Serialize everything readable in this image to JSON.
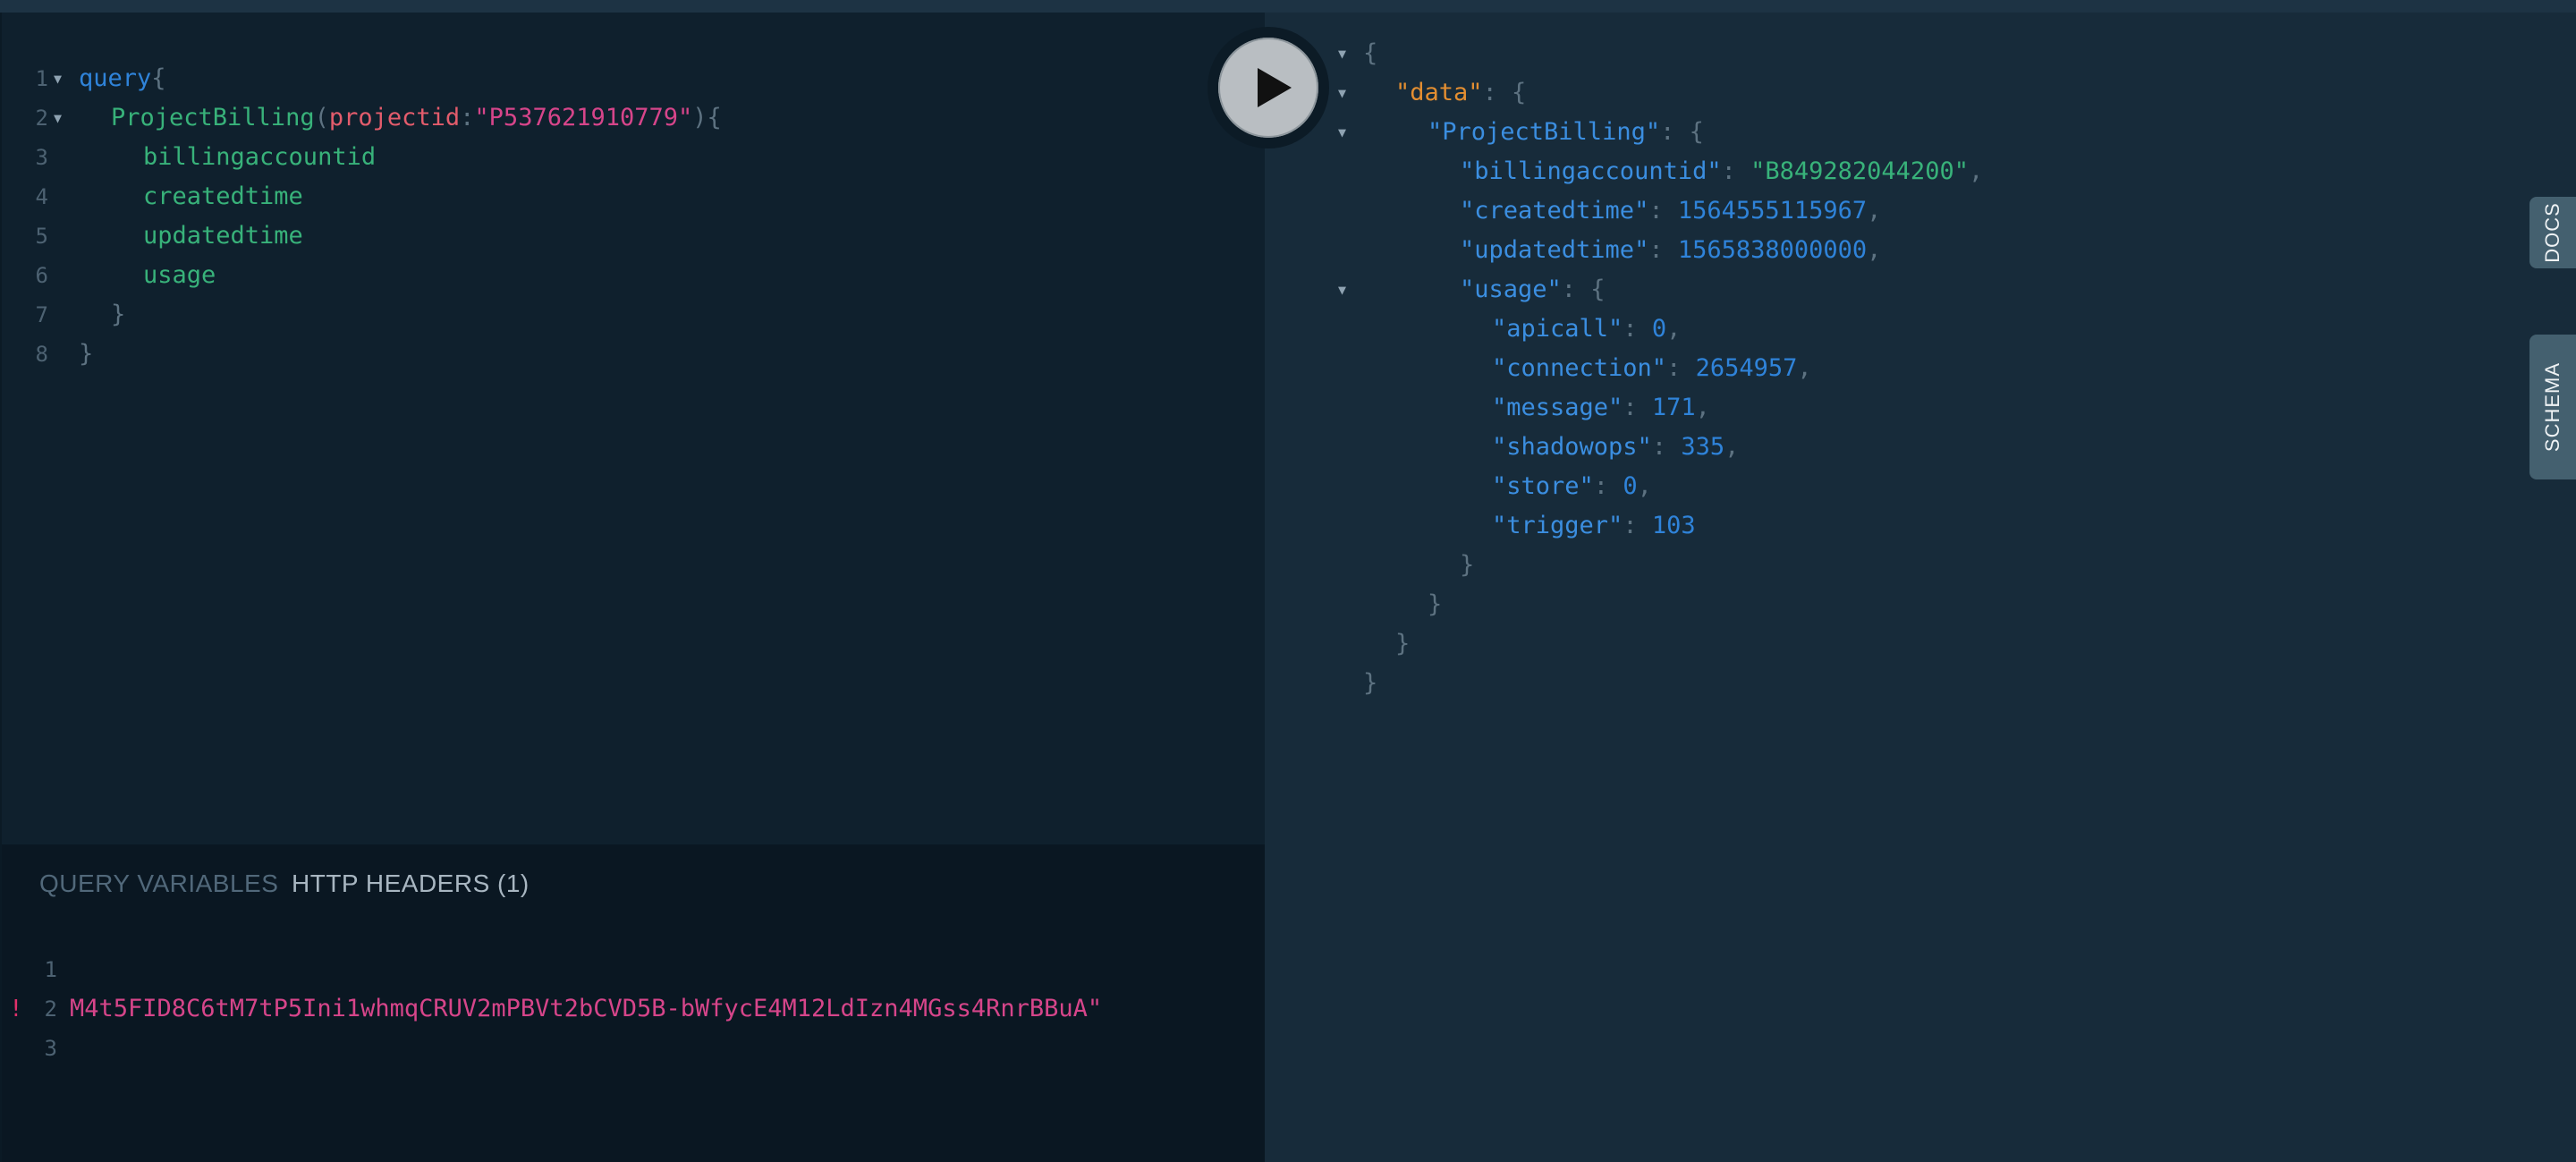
{
  "editor": {
    "lines": [
      {
        "n": "1",
        "fold": true,
        "indent": 0,
        "tokens": [
          {
            "t": "query",
            "c": "kw"
          },
          {
            "t": "{",
            "c": "punc"
          }
        ]
      },
      {
        "n": "2",
        "fold": true,
        "indent": 1,
        "tokens": [
          {
            "t": "ProjectBilling",
            "c": "fn"
          },
          {
            "t": "(",
            "c": "punc"
          },
          {
            "t": "projectid",
            "c": "arg"
          },
          {
            "t": ":",
            "c": "punc"
          },
          {
            "t": "\"P537621910779\"",
            "c": "str"
          },
          {
            "t": "){",
            "c": "punc"
          }
        ]
      },
      {
        "n": "3",
        "fold": false,
        "indent": 2,
        "tokens": [
          {
            "t": "billingaccountid",
            "c": "field"
          }
        ]
      },
      {
        "n": "4",
        "fold": false,
        "indent": 2,
        "tokens": [
          {
            "t": "createdtime",
            "c": "field"
          }
        ]
      },
      {
        "n": "5",
        "fold": false,
        "indent": 2,
        "tokens": [
          {
            "t": "updatedtime",
            "c": "field"
          }
        ]
      },
      {
        "n": "6",
        "fold": false,
        "indent": 2,
        "tokens": [
          {
            "t": "usage",
            "c": "field"
          }
        ]
      },
      {
        "n": "7",
        "fold": false,
        "indent": 1,
        "tokens": [
          {
            "t": "}",
            "c": "punc"
          }
        ]
      },
      {
        "n": "8",
        "fold": false,
        "indent": 0,
        "tokens": [
          {
            "t": "}",
            "c": "punc"
          }
        ]
      }
    ]
  },
  "bottom_tabs": {
    "query_variables": "QUERY VARIABLES",
    "http_headers": "HTTP HEADERS (1)"
  },
  "headers_editor": {
    "lines": [
      {
        "n": "1",
        "text": ""
      },
      {
        "n": "2",
        "text": "M4t5FID8C6tM7tP5Ini1whmqCRUV2mPBVt2bCVD5B-bWfycE4M12LdIzn4MGss4RnrBBuA\""
      },
      {
        "n": "3",
        "text": ""
      }
    ],
    "error_marker": "!"
  },
  "result": {
    "lines": [
      {
        "fold": true,
        "indent": 0,
        "tokens": [
          {
            "t": "{",
            "c": "punc"
          }
        ]
      },
      {
        "fold": true,
        "indent": 1,
        "tokens": [
          {
            "t": "\"data\"",
            "c": "key-data"
          },
          {
            "t": ": {",
            "c": "punc"
          }
        ]
      },
      {
        "fold": true,
        "indent": 2,
        "tokens": [
          {
            "t": "\"ProjectBilling\"",
            "c": "key"
          },
          {
            "t": ": {",
            "c": "punc"
          }
        ]
      },
      {
        "fold": false,
        "indent": 3,
        "tokens": [
          {
            "t": "\"billingaccountid\"",
            "c": "key"
          },
          {
            "t": ": ",
            "c": "punc"
          },
          {
            "t": "\"B849282044200\"",
            "c": "rstr"
          },
          {
            "t": ",",
            "c": "punc"
          }
        ]
      },
      {
        "fold": false,
        "indent": 3,
        "tokens": [
          {
            "t": "\"createdtime\"",
            "c": "key"
          },
          {
            "t": ": ",
            "c": "punc"
          },
          {
            "t": "1564555115967",
            "c": "num"
          },
          {
            "t": ",",
            "c": "punc"
          }
        ]
      },
      {
        "fold": false,
        "indent": 3,
        "tokens": [
          {
            "t": "\"updatedtime\"",
            "c": "key"
          },
          {
            "t": ": ",
            "c": "punc"
          },
          {
            "t": "1565838000000",
            "c": "num"
          },
          {
            "t": ",",
            "c": "punc"
          }
        ]
      },
      {
        "fold": true,
        "indent": 3,
        "tokens": [
          {
            "t": "\"usage\"",
            "c": "key"
          },
          {
            "t": ": {",
            "c": "punc"
          }
        ]
      },
      {
        "fold": false,
        "indent": 4,
        "tokens": [
          {
            "t": "\"apicall\"",
            "c": "key"
          },
          {
            "t": ": ",
            "c": "punc"
          },
          {
            "t": "0",
            "c": "num"
          },
          {
            "t": ",",
            "c": "punc"
          }
        ]
      },
      {
        "fold": false,
        "indent": 4,
        "tokens": [
          {
            "t": "\"connection\"",
            "c": "key"
          },
          {
            "t": ": ",
            "c": "punc"
          },
          {
            "t": "2654957",
            "c": "num"
          },
          {
            "t": ",",
            "c": "punc"
          }
        ]
      },
      {
        "fold": false,
        "indent": 4,
        "tokens": [
          {
            "t": "\"message\"",
            "c": "key"
          },
          {
            "t": ": ",
            "c": "punc"
          },
          {
            "t": "171",
            "c": "num"
          },
          {
            "t": ",",
            "c": "punc"
          }
        ]
      },
      {
        "fold": false,
        "indent": 4,
        "tokens": [
          {
            "t": "\"shadowops\"",
            "c": "key"
          },
          {
            "t": ": ",
            "c": "punc"
          },
          {
            "t": "335",
            "c": "num"
          },
          {
            "t": ",",
            "c": "punc"
          }
        ]
      },
      {
        "fold": false,
        "indent": 4,
        "tokens": [
          {
            "t": "\"store\"",
            "c": "key"
          },
          {
            "t": ": ",
            "c": "punc"
          },
          {
            "t": "0",
            "c": "num"
          },
          {
            "t": ",",
            "c": "punc"
          }
        ]
      },
      {
        "fold": false,
        "indent": 4,
        "tokens": [
          {
            "t": "\"trigger\"",
            "c": "key"
          },
          {
            "t": ": ",
            "c": "punc"
          },
          {
            "t": "103",
            "c": "num"
          }
        ]
      },
      {
        "fold": false,
        "indent": 3,
        "tokens": [
          {
            "t": "}",
            "c": "punc"
          }
        ]
      },
      {
        "fold": false,
        "indent": 2,
        "tokens": [
          {
            "t": "}",
            "c": "punc"
          }
        ]
      },
      {
        "fold": false,
        "indent": 1,
        "tokens": [
          {
            "t": "}",
            "c": "punc"
          }
        ]
      },
      {
        "fold": false,
        "indent": 0,
        "tokens": [
          {
            "t": "}",
            "c": "punc"
          }
        ]
      }
    ]
  },
  "side_tabs": {
    "docs": "DOCS",
    "schema": "SCHEMA"
  },
  "icons": {
    "play": "play-icon",
    "fold": "chevron-down-icon"
  }
}
